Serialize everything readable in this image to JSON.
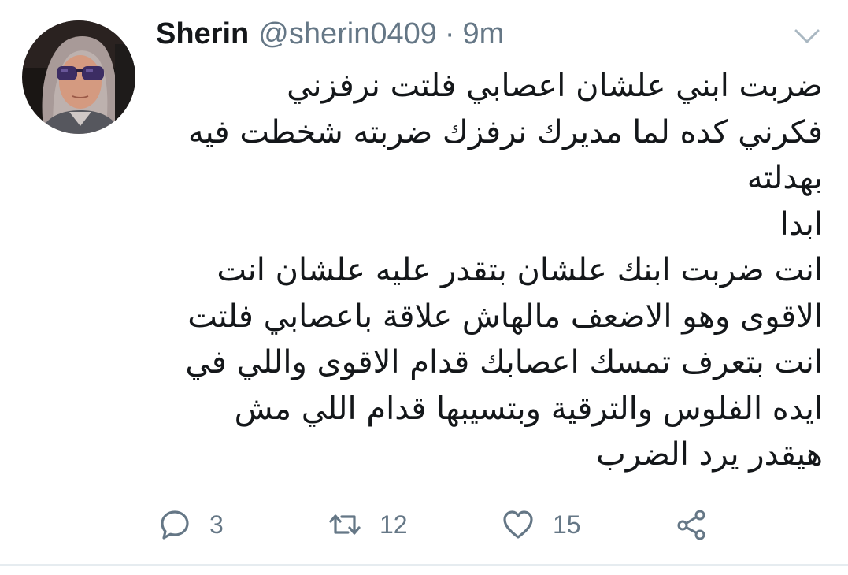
{
  "tweet": {
    "display_name": "Sherin",
    "handle": "@sherin0409",
    "separator": "·",
    "time": "9m",
    "lines": [
      "ضربت ابني علشان اعصابي فلتت نرفزني",
      "فكرني كده لما مديرك نرفزك ضربته شخطت فيه",
      "بهدلته",
      "ابدا",
      "انت ضربت ابنك علشان بتقدر عليه علشان انت",
      "الاقوى وهو الاضعف مالهاش علاقة باعصابي فلتت",
      "انت بتعرف تمسك اعصابك قدام الاقوى واللي في",
      "ايده الفلوس والترقية وبتسيبها قدام اللي مش",
      "هيقدر يرد الضرب"
    ],
    "actions": {
      "reply_count": "3",
      "retweet_count": "12",
      "like_count": "15"
    },
    "icons": {
      "reply": "reply-icon",
      "retweet": "retweet-icon",
      "like": "heart-icon",
      "share": "share-icon",
      "caret": "chevron-down-icon"
    },
    "colors": {
      "text": "#14171a",
      "muted": "#657786",
      "divider": "#e6ecf0"
    }
  }
}
